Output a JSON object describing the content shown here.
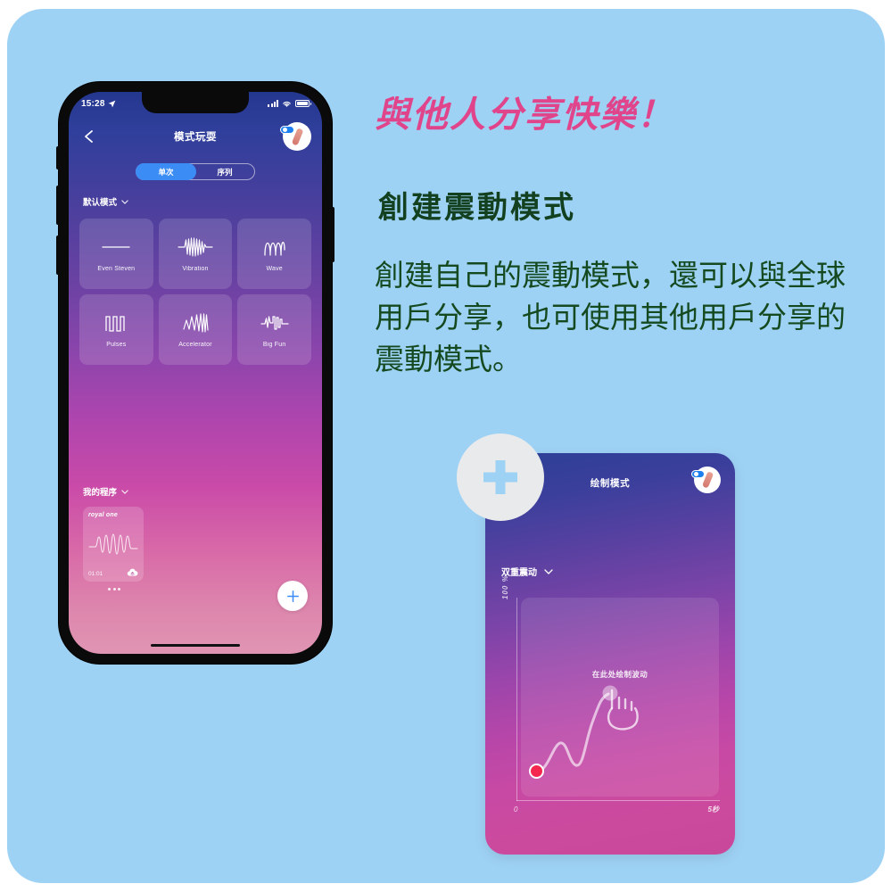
{
  "colors": {
    "backdrop": "#9ed2f5",
    "headline_pink": "#e0458b",
    "text_green": "#15491f",
    "accent_blue": "#3b8cf5",
    "start_dot_red": "#f5274f"
  },
  "phone": {
    "status_bar": {
      "time": "15:28",
      "location_icon": "location-arrow-icon",
      "signal_icon": "cellular-signal-icon",
      "wifi_icon": "wifi-icon",
      "battery_icon": "battery-icon"
    },
    "nav": {
      "back_icon": "back-chevron-icon",
      "title": "模式玩耍",
      "brand_icon": "lovense-toy-badge-icon"
    },
    "segmented": {
      "options": [
        {
          "label": "单次",
          "active": true
        },
        {
          "label": "序列",
          "active": false
        }
      ]
    },
    "sections": {
      "default_modes_label": "默认模式",
      "my_programs_label": "我的程序",
      "chevron_icon": "chevron-down-icon"
    },
    "patterns": [
      {
        "label": "Even Steven",
        "icon": "flat-line-wave-icon"
      },
      {
        "label": "Vibration",
        "icon": "dense-vibration-wave-icon"
      },
      {
        "label": "Wave",
        "icon": "sine-wave-icon"
      },
      {
        "label": "Pulses",
        "icon": "square-pulse-wave-icon"
      },
      {
        "label": "Accelerator",
        "icon": "accelerating-wave-icon"
      },
      {
        "label": "Big Fun",
        "icon": "big-fun-wave-icon"
      }
    ],
    "my_program_card": {
      "name": "royal one",
      "duration": "01:01",
      "cloud_icon": "cloud-upload-icon",
      "waveform_icon": "program-waveform-icon",
      "overflow_icon": "more-options-dots-icon"
    },
    "fab": {
      "icon": "plus-icon"
    },
    "home_indicator": "home-indicator"
  },
  "promo": {
    "headline": "與他人分享快樂！",
    "subhead": "創建震動模式",
    "body": "創建自己的震動模式，還可以與全球用戶分享，也可使用其他用戶分享的震動模式。"
  },
  "draw_card": {
    "plus_badge_icon": "plus-circle-icon",
    "title": "绘制模式",
    "brand_icon": "lovense-toy-badge-icon",
    "mode_label": "双重震动",
    "mode_chevron_icon": "chevron-down-icon",
    "y_axis_label": "100 %",
    "canvas_hint": "在此处绘制波动",
    "x_axis_start": "0",
    "x_axis_end": "5秒",
    "hand_icon": "drawing-hand-cursor-icon",
    "start_point_icon": "start-point-dot-icon"
  }
}
